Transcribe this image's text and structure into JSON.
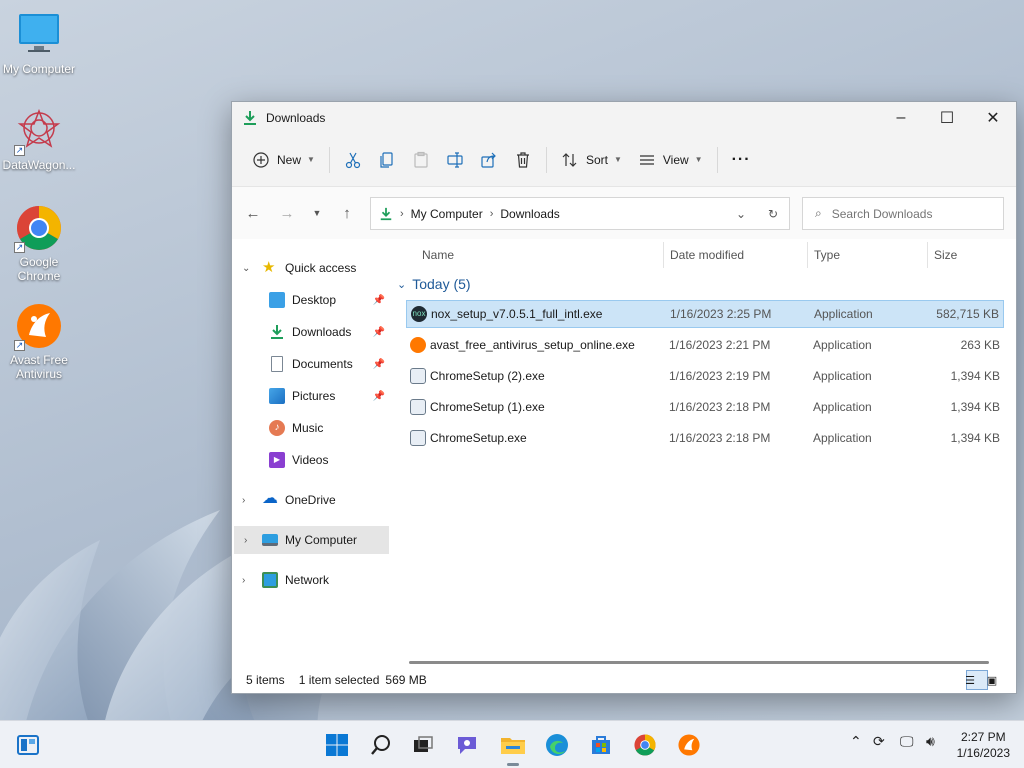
{
  "desktop": {
    "icons": [
      {
        "label": "My Computer",
        "icon": "monitor-icon"
      },
      {
        "label": "DataWagon...",
        "icon": "datawagon-icon"
      },
      {
        "label": "Google Chrome",
        "icon": "chrome-icon"
      },
      {
        "label": "Avast Free Antivirus",
        "icon": "avast-icon"
      }
    ]
  },
  "window": {
    "title": "Downloads",
    "controls": {
      "minimize": "–",
      "maximize": "☐",
      "close": "✕"
    }
  },
  "toolbar": {
    "new_label": "New",
    "sort_label": "Sort",
    "view_label": "View",
    "more_label": "···"
  },
  "address": {
    "crumbs": [
      "My Computer",
      "Downloads"
    ]
  },
  "search": {
    "placeholder": "Search Downloads"
  },
  "navpane": {
    "quick_access": "Quick access",
    "items": [
      {
        "label": "Desktop"
      },
      {
        "label": "Downloads"
      },
      {
        "label": "Documents"
      },
      {
        "label": "Pictures"
      },
      {
        "label": "Music"
      },
      {
        "label": "Videos"
      }
    ],
    "onedrive": "OneDrive",
    "my_computer": "My Computer",
    "network": "Network"
  },
  "columns": {
    "name": "Name",
    "date": "Date modified",
    "type": "Type",
    "size": "Size"
  },
  "group": {
    "label": "Today (5)"
  },
  "files": [
    {
      "name": "nox_setup_v7.0.5.1_full_intl.exe",
      "date": "1/16/2023 2:25 PM",
      "type": "Application",
      "size": "582,715 KB",
      "icon": "nox-icon"
    },
    {
      "name": "avast_free_antivirus_setup_online.exe",
      "date": "1/16/2023 2:21 PM",
      "type": "Application",
      "size": "263 KB",
      "icon": "avast-icon"
    },
    {
      "name": "ChromeSetup (2).exe",
      "date": "1/16/2023 2:19 PM",
      "type": "Application",
      "size": "1,394 KB",
      "icon": "installer-icon"
    },
    {
      "name": "ChromeSetup (1).exe",
      "date": "1/16/2023 2:18 PM",
      "type": "Application",
      "size": "1,394 KB",
      "icon": "installer-icon"
    },
    {
      "name": "ChromeSetup.exe",
      "date": "1/16/2023 2:18 PM",
      "type": "Application",
      "size": "1,394 KB",
      "icon": "installer-icon"
    }
  ],
  "status": {
    "items": "5 items",
    "selected": "1 item selected",
    "size": "569 MB"
  },
  "taskbar": {
    "time": "2:27 PM",
    "date": "1/16/2023"
  },
  "colors": {
    "accent": "#0067c0",
    "selection": "#cce4f7",
    "group_blue": "#1f5a98"
  }
}
